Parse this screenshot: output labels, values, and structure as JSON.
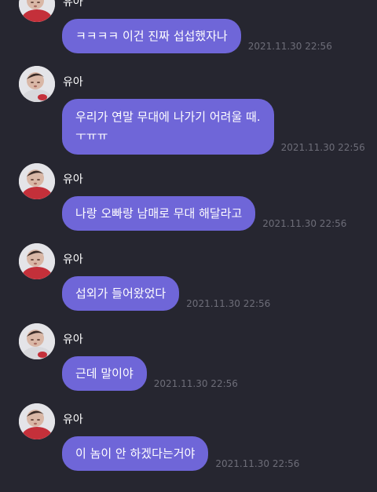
{
  "sender_name": "유아",
  "avatar_icon": "baby-photo-avatar",
  "colors": {
    "background": "#262630",
    "bubble": "#6f66d8",
    "bubble_text": "#ffffff",
    "timestamp": "#6d6d78"
  },
  "messages": [
    {
      "text": "ㅋㅋㅋㅋ 이건 진짜 섭섭했자나",
      "time": "2021.11.30 22:56"
    },
    {
      "lines": [
        "우리가 연말 무대에 나가기 어려울 때.",
        "ㅜㅠㅠ"
      ],
      "time": "2021.11.30 22:56"
    },
    {
      "text": "나랑 오빠랑 남매로 무대 해달라고",
      "time": "2021.11.30 22:56"
    },
    {
      "text": "섭외가 들어왔었다",
      "time": "2021.11.30 22:56"
    },
    {
      "text": "근데 말이야",
      "time": "2021.11.30 22:56"
    },
    {
      "text": "이 놈이 안 하겠다는거야",
      "time": "2021.11.30 22:56"
    }
  ]
}
